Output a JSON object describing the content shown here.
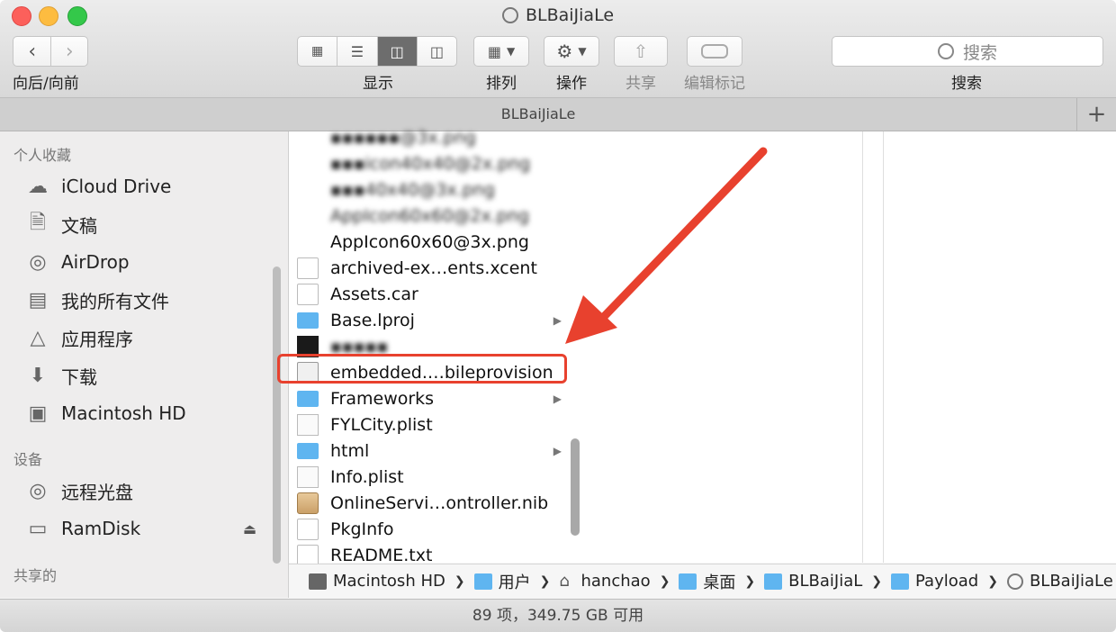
{
  "window": {
    "title": "BLBaiJiaLe"
  },
  "toolbar": {
    "nav_label": "向后/向前",
    "view_label": "显示",
    "arrange_label": "排列",
    "action_label": "操作",
    "share_label": "共享",
    "tags_label": "编辑标记",
    "search_label": "搜索",
    "search_placeholder": "搜索"
  },
  "tabbar": {
    "title": "BLBaiJiaLe",
    "add_glyph": "+"
  },
  "sidebar": {
    "favorites_header": "个人收藏",
    "favorites": [
      {
        "label": "iCloud Drive",
        "icon": "cloud-icon"
      },
      {
        "label": "文稿",
        "icon": "documents-icon"
      },
      {
        "label": "AirDrop",
        "icon": "airdrop-icon"
      },
      {
        "label": "我的所有文件",
        "icon": "all-files-icon"
      },
      {
        "label": "应用程序",
        "icon": "applications-icon"
      },
      {
        "label": "下载",
        "icon": "downloads-icon"
      },
      {
        "label": "Macintosh HD",
        "icon": "disk-icon"
      }
    ],
    "devices_header": "设备",
    "devices": [
      {
        "label": "远程光盘",
        "icon": "optical-disc-icon"
      },
      {
        "label": "RamDisk",
        "icon": "drive-icon"
      }
    ],
    "shared_header": "共享的"
  },
  "files": [
    {
      "name": "▪▪▪▪▪▪@3x.png",
      "icon": "image",
      "blurred": true
    },
    {
      "name": "▪▪▪icon40x40@2x.png",
      "icon": "image",
      "blurred": true
    },
    {
      "name": "▪▪▪40x40@3x.png",
      "icon": "image",
      "blurred": true
    },
    {
      "name": "AppIcon60x60@2x.png",
      "icon": "image",
      "blurred": true
    },
    {
      "name": "AppIcon60x60@3x.png",
      "icon": "image",
      "blurred": false
    },
    {
      "name": "archived-ex…ents.xcent",
      "icon": "doc",
      "blurred": false
    },
    {
      "name": "Assets.car",
      "icon": "doc",
      "blurred": false
    },
    {
      "name": "Base.lproj",
      "icon": "folder",
      "blurred": false,
      "has_children": true
    },
    {
      "name": "▪▪▪▪▪",
      "icon": "dark",
      "blurred": true
    },
    {
      "name": "embedded.…bileprovision",
      "icon": "prov",
      "blurred": false,
      "highlighted": true
    },
    {
      "name": "Frameworks",
      "icon": "folder",
      "blurred": false,
      "has_children": true
    },
    {
      "name": "FYLCity.plist",
      "icon": "plist",
      "blurred": false
    },
    {
      "name": "html",
      "icon": "folder",
      "blurred": false,
      "has_children": true
    },
    {
      "name": "Info.plist",
      "icon": "plist",
      "blurred": false
    },
    {
      "name": "OnlineServi…ontroller.nib",
      "icon": "nib",
      "blurred": false
    },
    {
      "name": "PkgInfo",
      "icon": "doc",
      "blurred": false
    },
    {
      "name": "README.txt",
      "icon": "doc",
      "blurred": false
    }
  ],
  "pathbar": {
    "items": [
      {
        "label": "Macintosh HD",
        "icon": "hd"
      },
      {
        "label": "用户",
        "icon": "fold"
      },
      {
        "label": "hanchao",
        "icon": "home"
      },
      {
        "label": "桌面",
        "icon": "fold"
      },
      {
        "label": "BLBaiJiaL",
        "icon": "fold"
      },
      {
        "label": "Payload",
        "icon": "fold"
      },
      {
        "label": "BLBaiJiaLe",
        "icon": "app"
      }
    ]
  },
  "status": {
    "text": "89 项，349.75 GB 可用"
  },
  "colors": {
    "annotation": "#e8412e",
    "folder": "#5fb5f0"
  }
}
